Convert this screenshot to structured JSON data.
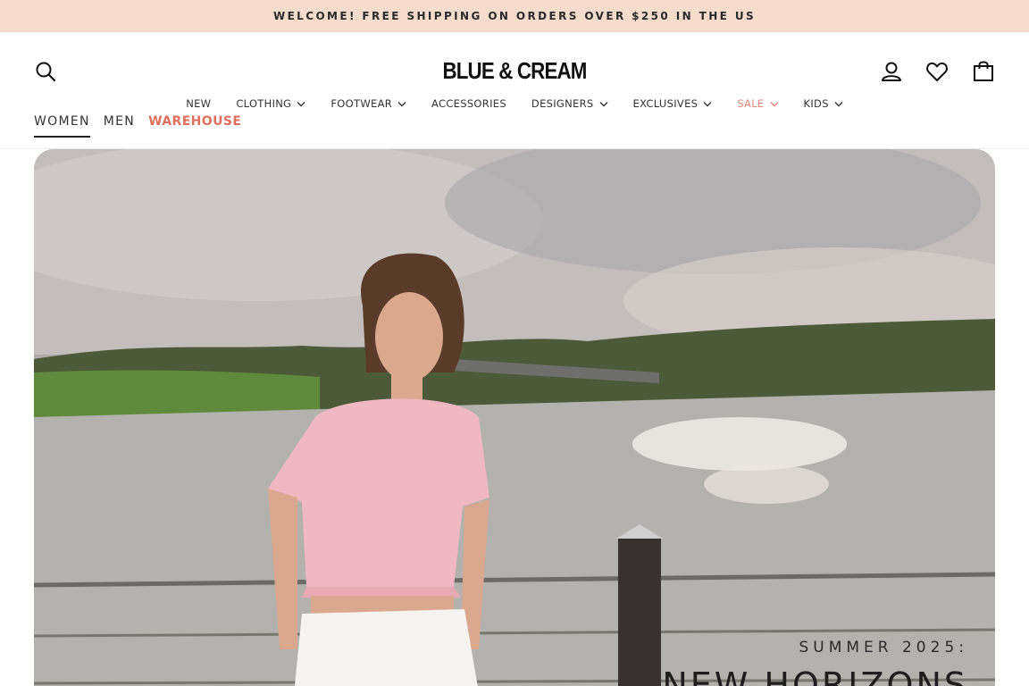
{
  "announcement": "WELCOME! FREE SHIPPING ON ORDERS OVER $250 IN THE US",
  "brand": "BLUE & CREAM",
  "icons": {
    "search": "search-icon",
    "account": "account-icon",
    "wishlist": "heart-icon",
    "cart": "cart-icon"
  },
  "nav": [
    {
      "label": "NEW",
      "dropdown": false
    },
    {
      "label": "CLOTHING",
      "dropdown": true
    },
    {
      "label": "FOOTWEAR",
      "dropdown": true
    },
    {
      "label": "ACCESSORIES",
      "dropdown": false
    },
    {
      "label": "DESIGNERS",
      "dropdown": true
    },
    {
      "label": "EXCLUSIVES",
      "dropdown": true
    },
    {
      "label": "SALE",
      "dropdown": true
    },
    {
      "label": "KIDS",
      "dropdown": true
    }
  ],
  "gender_tabs": [
    {
      "label": "WOMEN",
      "active": true
    },
    {
      "label": "MEN",
      "active": false
    },
    {
      "label": "WAREHOUSE",
      "active": false
    }
  ],
  "hero": {
    "kicker": "SUMMER 2025:",
    "title": "NEW HORIZONS"
  },
  "colors": {
    "announcement_bg": "#f6dccd",
    "sale": "#e0887a",
    "warehouse": "#e0705e"
  }
}
